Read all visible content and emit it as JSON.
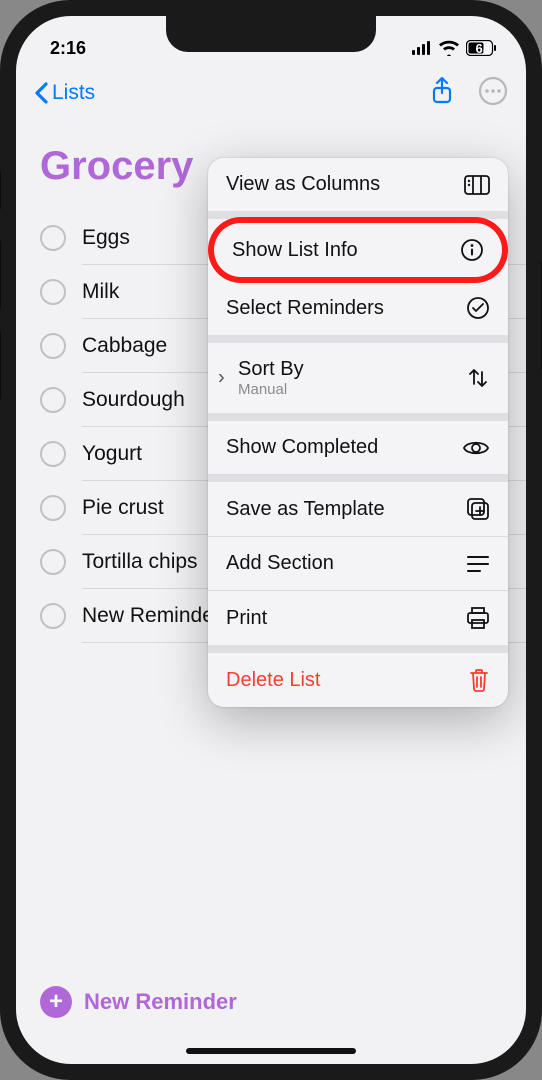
{
  "status": {
    "time": "2:16",
    "battery": "65"
  },
  "nav": {
    "back_label": "Lists"
  },
  "page": {
    "title": "Grocery"
  },
  "reminders": [
    "Eggs",
    "Milk",
    "Cabbage",
    "Sourdough",
    "Yogurt",
    "Pie crust",
    "Tortilla chips",
    "New Reminder"
  ],
  "footer": {
    "new_reminder": "New Reminder"
  },
  "menu": {
    "view_columns": "View as Columns",
    "show_list_info": "Show List Info",
    "select_reminders": "Select Reminders",
    "sort_by": "Sort By",
    "sort_by_value": "Manual",
    "show_completed": "Show Completed",
    "save_template": "Save as Template",
    "add_section": "Add Section",
    "print": "Print",
    "delete_list": "Delete List"
  }
}
